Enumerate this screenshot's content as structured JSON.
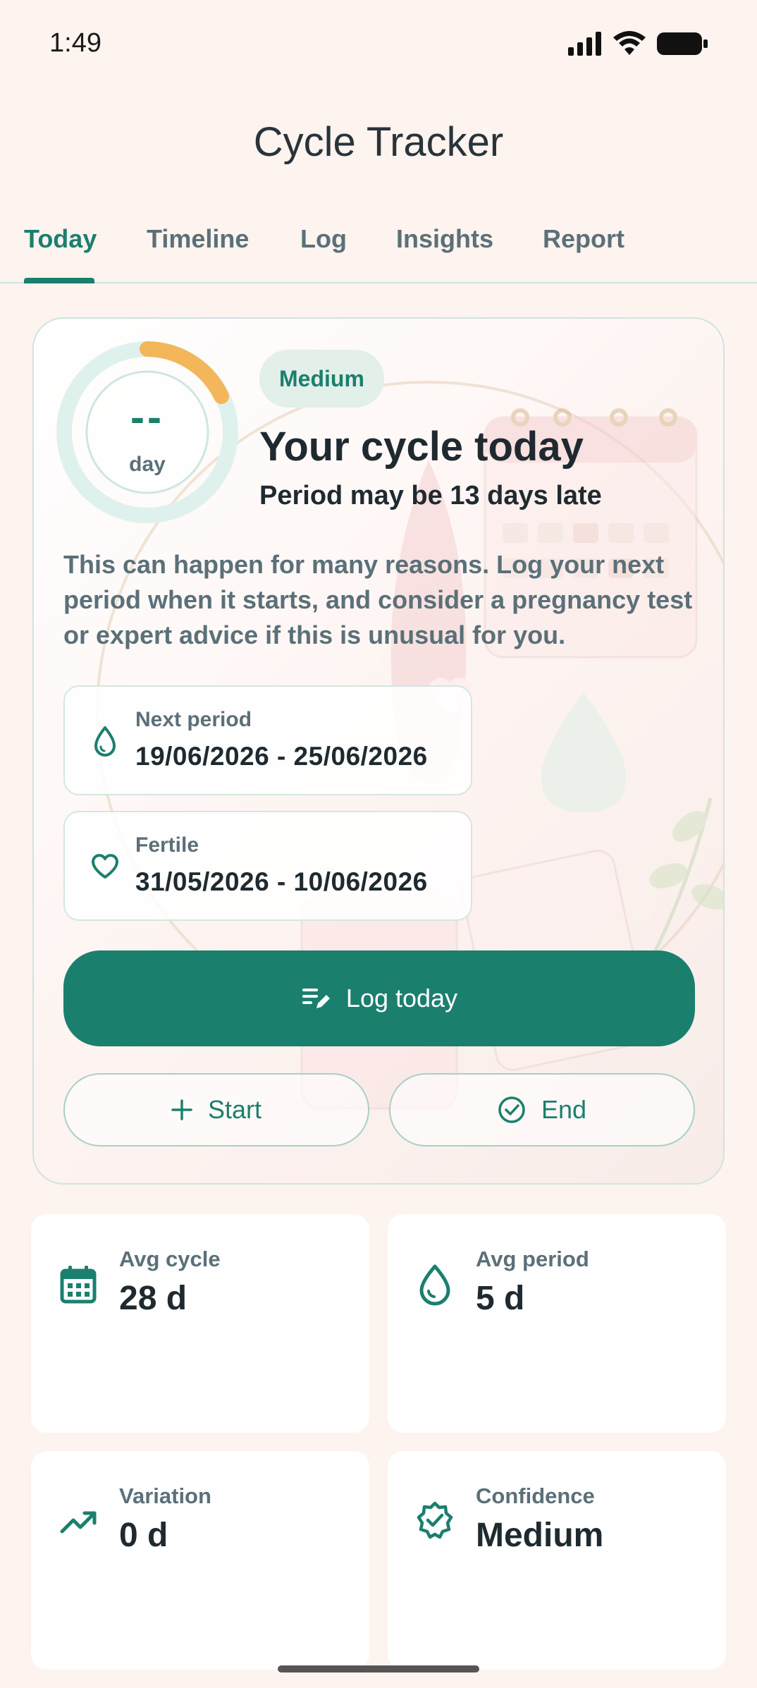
{
  "status_bar": {
    "time": "1:49"
  },
  "app": {
    "title": "Cycle Tracker"
  },
  "tabs": [
    {
      "label": "Today"
    },
    {
      "label": "Timeline"
    },
    {
      "label": "Log"
    },
    {
      "label": "Insights"
    },
    {
      "label": "Report"
    }
  ],
  "hero": {
    "ring_value": "--",
    "ring_unit": "day",
    "confidence_badge": "Medium",
    "title": "Your cycle today",
    "subtitle": "Period may be 13 days late",
    "description": "This can happen for many reasons. Log your next period when it starts, and consider a pregnancy test or expert advice if this is unusual for you.",
    "next_period": {
      "label": "Next period",
      "value": "19/06/2026 - 25/06/2026",
      "icon": "drop-icon"
    },
    "fertile": {
      "label": "Fertile",
      "value": "31/05/2026 - 10/06/2026",
      "icon": "heart-icon"
    },
    "log_today_label": "Log today",
    "start_label": "Start",
    "end_label": "End"
  },
  "stats": [
    {
      "label": "Avg cycle",
      "value": "28 d",
      "icon": "calendar-icon"
    },
    {
      "label": "Avg period",
      "value": "5 d",
      "icon": "drop-icon"
    },
    {
      "label": "Variation",
      "value": "0 d",
      "icon": "trend-icon"
    },
    {
      "label": "Confidence",
      "value": "Medium",
      "icon": "verified-badge-icon"
    }
  ],
  "colors": {
    "accent": "#1b7f6e",
    "ring_progress": "#f4b65a",
    "background": "#fdf3ef"
  }
}
